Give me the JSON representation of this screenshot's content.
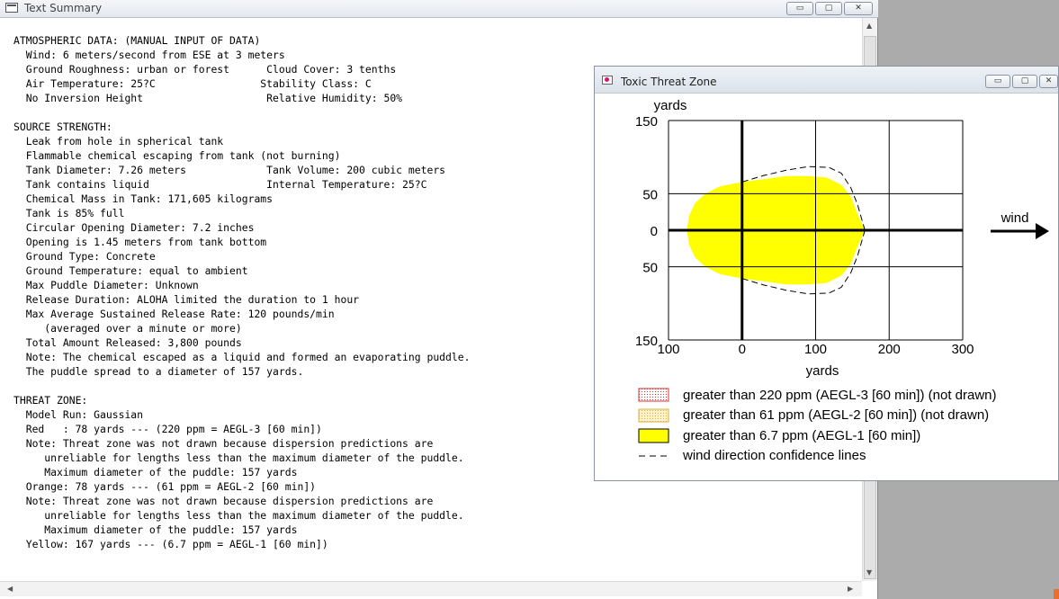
{
  "summary_window": {
    "title": "Text Summary",
    "buttons": {
      "minimize": "▭",
      "maximize": "▢",
      "close": "✕"
    },
    "lines": [
      "ATMOSPHERIC DATA: (MANUAL INPUT OF DATA)",
      "  Wind: 6 meters/second from ESE at 3 meters",
      "  Ground Roughness: urban or forest      Cloud Cover: 3 tenths",
      "  Air Temperature: 25?C                 Stability Class: C",
      "  No Inversion Height                    Relative Humidity: 50%",
      "",
      "SOURCE STRENGTH:",
      "  Leak from hole in spherical tank",
      "  Flammable chemical escaping from tank (not burning)",
      "  Tank Diameter: 7.26 meters             Tank Volume: 200 cubic meters",
      "  Tank contains liquid                   Internal Temperature: 25?C",
      "  Chemical Mass in Tank: 171,605 kilograms",
      "  Tank is 85% full",
      "  Circular Opening Diameter: 7.2 inches",
      "  Opening is 1.45 meters from tank bottom",
      "  Ground Type: Concrete",
      "  Ground Temperature: equal to ambient",
      "  Max Puddle Diameter: Unknown",
      "  Release Duration: ALOHA limited the duration to 1 hour",
      "  Max Average Sustained Release Rate: 120 pounds/min",
      "     (averaged over a minute or more)",
      "  Total Amount Released: 3,800 pounds",
      "  Note: The chemical escaped as a liquid and formed an evaporating puddle.",
      "  The puddle spread to a diameter of 157 yards.",
      "",
      "THREAT ZONE:",
      "  Model Run: Gaussian",
      "  Red   : 78 yards --- (220 ppm = AEGL-3 [60 min])",
      "  Note: Threat zone was not drawn because dispersion predictions are",
      "     unreliable for lengths less than the maximum diameter of the puddle.",
      "     Maximum diameter of the puddle: 157 yards",
      "  Orange: 78 yards --- (61 ppm = AEGL-2 [60 min])",
      "  Note: Threat zone was not drawn because dispersion predictions are",
      "     unreliable for lengths less than the maximum diameter of the puddle.",
      "     Maximum diameter of the puddle: 157 yards",
      "  Yellow: 167 yards --- (6.7 ppm = AEGL-1 [60 min])"
    ]
  },
  "threat_window": {
    "title": "Toxic Threat Zone",
    "buttons": {
      "minimize": "▭",
      "maximize": "▢",
      "close": "✕"
    },
    "wind_label": "wind",
    "legend": [
      {
        "label": "greater than 220 ppm (AEGL-3 [60 min]) (not drawn)",
        "swatch": "dotted-red"
      },
      {
        "label": "greater than 61 ppm (AEGL-2 [60 min]) (not drawn)",
        "swatch": "dotted-orange"
      },
      {
        "label": "greater than 6.7 ppm (AEGL-1 [60 min])",
        "swatch": "yellow"
      },
      {
        "label": "wind direction confidence lines",
        "swatch": "dashed"
      }
    ],
    "colors": {
      "yellow_zone": "#ffff00",
      "red_swatch": "#d33",
      "orange_swatch": "#d8b04a",
      "accent_magenta": "#e0116b"
    }
  },
  "chart_data": {
    "type": "area",
    "xlabel": "yards",
    "ylabel": "yards",
    "xlim": [
      -100,
      300
    ],
    "ylim": [
      -150,
      150
    ],
    "x_ticks": [
      "100",
      "0",
      "100",
      "200",
      "300"
    ],
    "y_ticks": [
      "150",
      "50",
      "0",
      "50",
      "150"
    ],
    "grid": true,
    "series": [
      {
        "name": "greater than 6.7 ppm (AEGL-1 [60 min])",
        "kind": "filled",
        "points": [
          [
            -75,
            0
          ],
          [
            -72,
            20
          ],
          [
            -64,
            37
          ],
          [
            -50,
            50
          ],
          [
            -30,
            60
          ],
          [
            0,
            66
          ],
          [
            30,
            70
          ],
          [
            60,
            74
          ],
          [
            90,
            74
          ],
          [
            115,
            72
          ],
          [
            135,
            62
          ],
          [
            148,
            46
          ],
          [
            157,
            22
          ],
          [
            167,
            0
          ],
          [
            157,
            -22
          ],
          [
            148,
            -46
          ],
          [
            135,
            -62
          ],
          [
            115,
            -72
          ],
          [
            90,
            -74
          ],
          [
            60,
            -74
          ],
          [
            30,
            -70
          ],
          [
            0,
            -66
          ],
          [
            -30,
            -60
          ],
          [
            -50,
            -50
          ],
          [
            -64,
            -37
          ],
          [
            -72,
            -20
          ],
          [
            -75,
            0
          ]
        ]
      },
      {
        "name": "wind direction confidence lines",
        "kind": "dashed",
        "lines": [
          [
            [
              0,
              66
            ],
            [
              30,
              75
            ],
            [
              60,
              82
            ],
            [
              90,
              87
            ],
            [
              118,
              86
            ],
            [
              135,
              78
            ],
            [
              148,
              58
            ],
            [
              157,
              35
            ],
            [
              167,
              0
            ]
          ],
          [
            [
              0,
              -66
            ],
            [
              30,
              -75
            ],
            [
              60,
              -82
            ],
            [
              90,
              -87
            ],
            [
              118,
              -86
            ],
            [
              135,
              -78
            ],
            [
              148,
              -58
            ],
            [
              157,
              -35
            ],
            [
              167,
              0
            ]
          ]
        ]
      }
    ]
  }
}
